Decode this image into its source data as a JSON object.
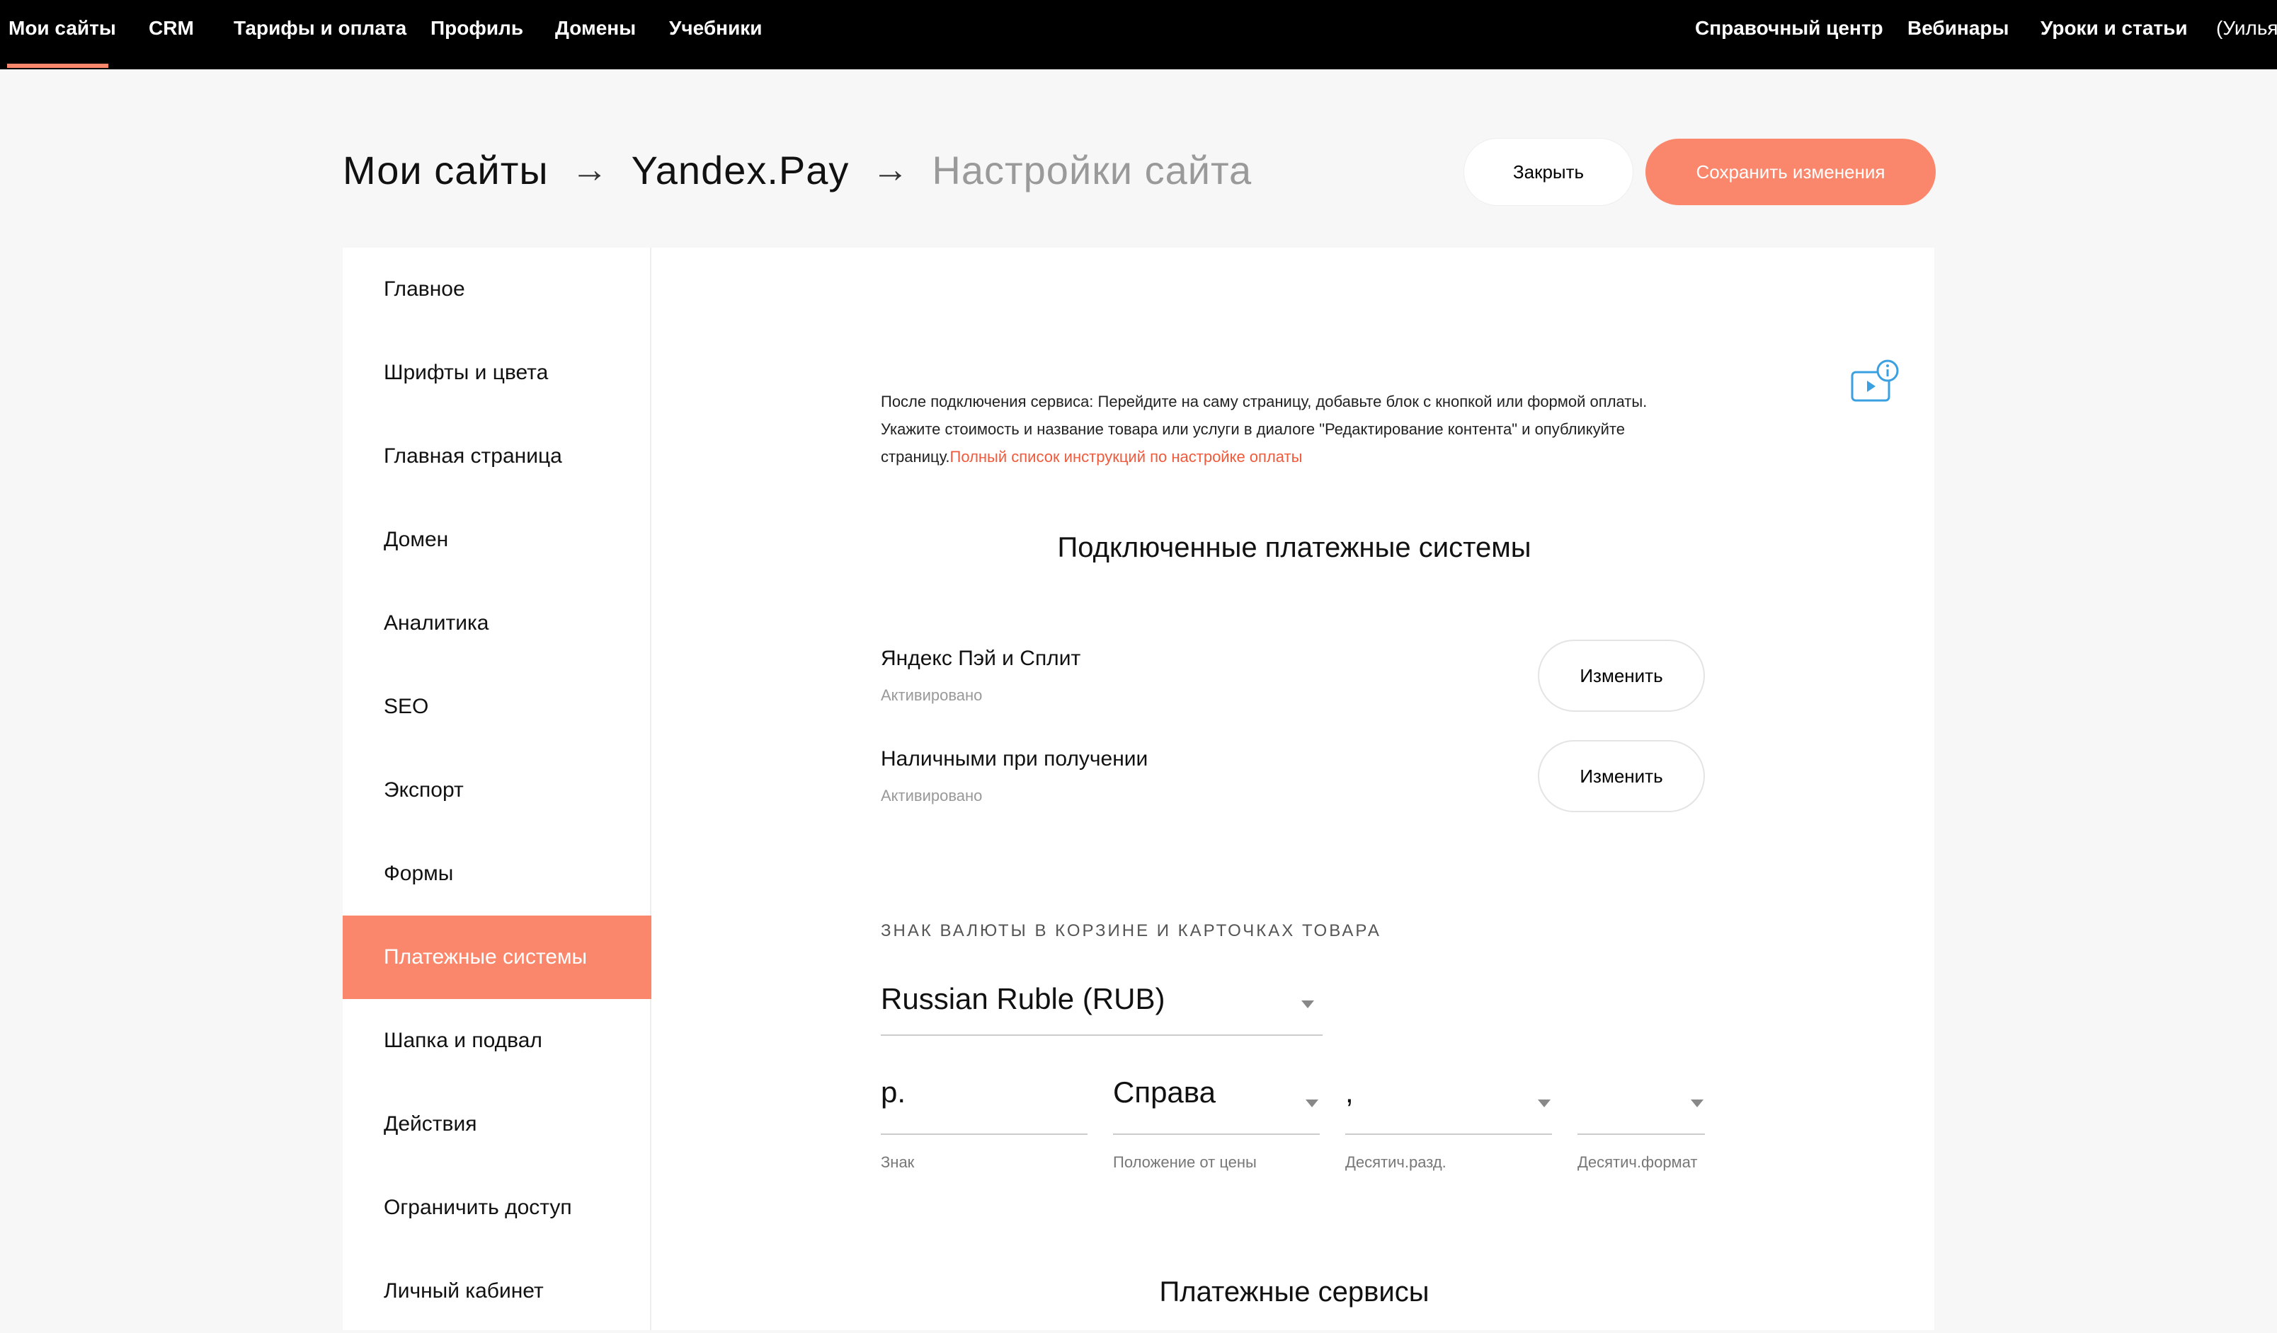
{
  "topnav": {
    "left": [
      "Мои сайты",
      "CRM",
      "Тарифы и оплата",
      "Профиль",
      "Домены",
      "Учебники"
    ],
    "right": [
      "Справочный центр",
      "Вебинары",
      "Уроки и статьи",
      "(Уильям"
    ]
  },
  "breadcrumb": {
    "root": "Мои сайты",
    "site": "Yandex.Pay",
    "current": "Настройки сайта",
    "separator": "→"
  },
  "buttons": {
    "close": "Закрыть",
    "save": "Сохранить изменения"
  },
  "sidebar": {
    "items": [
      "Главное",
      "Шрифты и цвета",
      "Главная страница",
      "Домен",
      "Аналитика",
      "SEO",
      "Экспорт",
      "Формы",
      "Платежные системы",
      "Шапка и подвал",
      "Действия",
      "Ограничить доступ",
      "Личный кабинет"
    ],
    "active": "Платежные системы"
  },
  "info": {
    "text": "После подключения сервиса: Перейдите на саму страницу, добавьте блок с кнопкой или формой оплаты. Укажите стоимость и название товара или услуги в диалоге \"Редактирование контента\" и опубликуйте страницу.",
    "link": "Полный список инструкций по настройке оплаты"
  },
  "connected": {
    "title": "Подключенные платежные системы",
    "systems": [
      {
        "name": "Яндекс Пэй и Сплит",
        "status": "Активировано",
        "action": "Изменить"
      },
      {
        "name": "Наличными при получении",
        "status": "Активировано",
        "action": "Изменить"
      }
    ]
  },
  "currency": {
    "label": "ЗНАК ВАЛЮТЫ В КОРЗИНЕ И КАРТОЧКАХ ТОВАРА",
    "selected": "Russian Ruble (RUB)",
    "sign": {
      "value": "р.",
      "label": "Знак"
    },
    "position": {
      "value": "Справа",
      "label": "Положение от цены"
    },
    "decimal_separator": {
      "value": ",",
      "label": "Десятич.разд."
    },
    "decimal_format": {
      "value": "",
      "label": "Десятич.формат"
    }
  },
  "services": {
    "title": "Платежные сервисы"
  },
  "colors": {
    "accent": "#fa876b",
    "link": "#f05a3c",
    "video_icon": "#3aa0e0"
  }
}
